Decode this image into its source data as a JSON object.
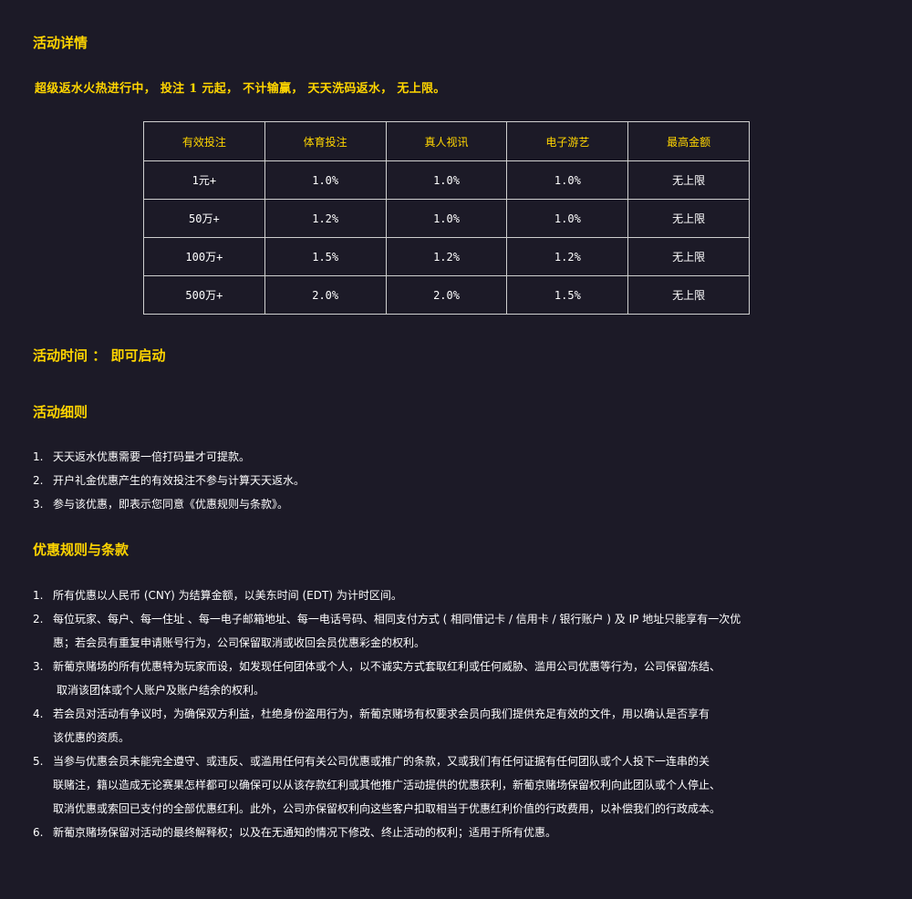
{
  "section_title": "活动详情",
  "intro": "超级返水火热进行中， 投注 1 元起， 不计输赢， 天天洗码返水， 无上限。",
  "table": {
    "headers": [
      "有效投注",
      "体育投注",
      "真人视讯",
      "电子游艺",
      "最高金额"
    ],
    "rows": [
      [
        "1元+",
        "1.0%",
        "1.0%",
        "1.0%",
        "无上限"
      ],
      [
        "50万+",
        "1.2%",
        "1.0%",
        "1.0%",
        "无上限"
      ],
      [
        "100万+",
        "1.5%",
        "1.2%",
        "1.2%",
        "无上限"
      ],
      [
        "500万+",
        "2.0%",
        "2.0%",
        "1.5%",
        "无上限"
      ]
    ]
  },
  "activity_time": "活动时间 ： 即可启动",
  "rules_title": "活动细则",
  "rules": [
    {
      "num": "1.",
      "text": "天天返水优惠需要一倍打码量才可提款。"
    },
    {
      "num": "2.",
      "text": "开户礼金优惠产生的有效投注不参与计算天天返水。"
    },
    {
      "num": "3.",
      "text": "参与该优惠，即表示您同意《优惠规则与条款》。"
    }
  ],
  "terms_title": "优惠规则与条款",
  "terms": [
    {
      "num": "1.",
      "lines": [
        "所有优惠以人民币 (CNY) 为结算金额，以美东时间 (EDT) 为计时区间。"
      ]
    },
    {
      "num": "2.",
      "lines": [
        "每位玩家、每户、每一住址 、每一电子邮箱地址、每一电话号码、相同支付方式 ( 相同借记卡 / 信用卡 / 银行账户 ) 及 IP 地址只能享有一次优",
        "惠；若会员有重复申请账号行为，公司保留取消或收回会员优惠彩金的权利。"
      ]
    },
    {
      "num": "3.",
      "lines": [
        "新葡京赌场的所有优惠特为玩家而设，如发现任何团体或个人，以不诚实方式套取红利或任何威胁、滥用公司优惠等行为，公司保留冻结、",
        " 取消该团体或个人账户及账户结余的权利。"
      ]
    },
    {
      "num": "4.",
      "lines": [
        "若会员对活动有争议时，为确保双方利益，杜绝身份盗用行为，新葡京赌场有权要求会员向我们提供充足有效的文件，用以确认是否享有",
        "该优惠的资质。"
      ]
    },
    {
      "num": "5.",
      "lines": [
        "当参与优惠会员未能完全遵守、或违反、或滥用任何有关公司优惠或推广的条款，又或我们有任何证据有任何团队或个人投下一连串的关",
        "联赌注，籍以造成无论赛果怎样都可以确保可以从该存款红利或其他推广活动提供的优惠获利，新葡京赌场保留权利向此团队或个人停止、",
        "取消优惠或索回已支付的全部优惠红利。此外，公司亦保留权利向这些客户扣取相当于优惠红利价值的行政费用，以补偿我们的行政成本。"
      ]
    },
    {
      "num": "6.",
      "lines": [
        "新葡京赌场保留对活动的最终解释权；以及在无通知的情况下修改、终止活动的权利；适用于所有优惠。"
      ]
    }
  ]
}
